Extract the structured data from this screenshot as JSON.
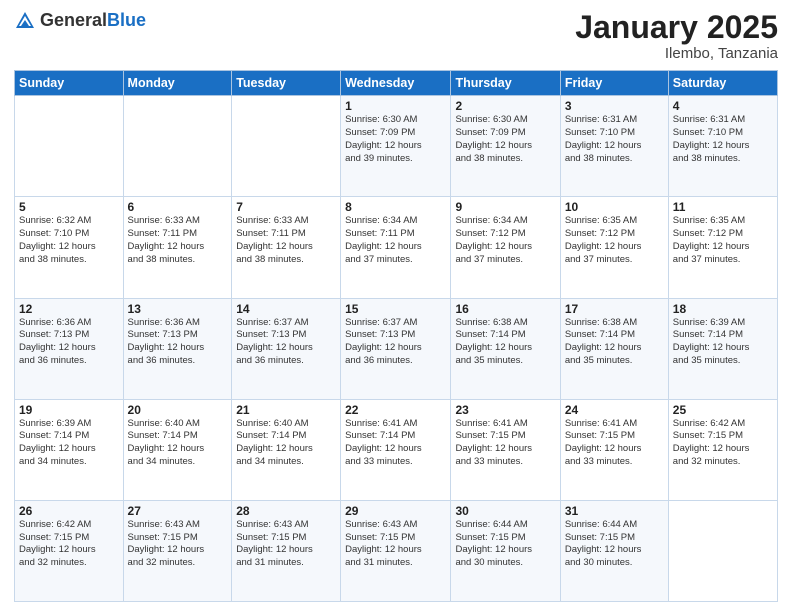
{
  "header": {
    "logo_general": "General",
    "logo_blue": "Blue",
    "month": "January 2025",
    "location": "Ilembo, Tanzania"
  },
  "weekdays": [
    "Sunday",
    "Monday",
    "Tuesday",
    "Wednesday",
    "Thursday",
    "Friday",
    "Saturday"
  ],
  "weeks": [
    [
      {
        "day": "",
        "info": ""
      },
      {
        "day": "",
        "info": ""
      },
      {
        "day": "",
        "info": ""
      },
      {
        "day": "1",
        "info": "Sunrise: 6:30 AM\nSunset: 7:09 PM\nDaylight: 12 hours\nand 39 minutes."
      },
      {
        "day": "2",
        "info": "Sunrise: 6:30 AM\nSunset: 7:09 PM\nDaylight: 12 hours\nand 38 minutes."
      },
      {
        "day": "3",
        "info": "Sunrise: 6:31 AM\nSunset: 7:10 PM\nDaylight: 12 hours\nand 38 minutes."
      },
      {
        "day": "4",
        "info": "Sunrise: 6:31 AM\nSunset: 7:10 PM\nDaylight: 12 hours\nand 38 minutes."
      }
    ],
    [
      {
        "day": "5",
        "info": "Sunrise: 6:32 AM\nSunset: 7:10 PM\nDaylight: 12 hours\nand 38 minutes."
      },
      {
        "day": "6",
        "info": "Sunrise: 6:33 AM\nSunset: 7:11 PM\nDaylight: 12 hours\nand 38 minutes."
      },
      {
        "day": "7",
        "info": "Sunrise: 6:33 AM\nSunset: 7:11 PM\nDaylight: 12 hours\nand 38 minutes."
      },
      {
        "day": "8",
        "info": "Sunrise: 6:34 AM\nSunset: 7:11 PM\nDaylight: 12 hours\nand 37 minutes."
      },
      {
        "day": "9",
        "info": "Sunrise: 6:34 AM\nSunset: 7:12 PM\nDaylight: 12 hours\nand 37 minutes."
      },
      {
        "day": "10",
        "info": "Sunrise: 6:35 AM\nSunset: 7:12 PM\nDaylight: 12 hours\nand 37 minutes."
      },
      {
        "day": "11",
        "info": "Sunrise: 6:35 AM\nSunset: 7:12 PM\nDaylight: 12 hours\nand 37 minutes."
      }
    ],
    [
      {
        "day": "12",
        "info": "Sunrise: 6:36 AM\nSunset: 7:13 PM\nDaylight: 12 hours\nand 36 minutes."
      },
      {
        "day": "13",
        "info": "Sunrise: 6:36 AM\nSunset: 7:13 PM\nDaylight: 12 hours\nand 36 minutes."
      },
      {
        "day": "14",
        "info": "Sunrise: 6:37 AM\nSunset: 7:13 PM\nDaylight: 12 hours\nand 36 minutes."
      },
      {
        "day": "15",
        "info": "Sunrise: 6:37 AM\nSunset: 7:13 PM\nDaylight: 12 hours\nand 36 minutes."
      },
      {
        "day": "16",
        "info": "Sunrise: 6:38 AM\nSunset: 7:14 PM\nDaylight: 12 hours\nand 35 minutes."
      },
      {
        "day": "17",
        "info": "Sunrise: 6:38 AM\nSunset: 7:14 PM\nDaylight: 12 hours\nand 35 minutes."
      },
      {
        "day": "18",
        "info": "Sunrise: 6:39 AM\nSunset: 7:14 PM\nDaylight: 12 hours\nand 35 minutes."
      }
    ],
    [
      {
        "day": "19",
        "info": "Sunrise: 6:39 AM\nSunset: 7:14 PM\nDaylight: 12 hours\nand 34 minutes."
      },
      {
        "day": "20",
        "info": "Sunrise: 6:40 AM\nSunset: 7:14 PM\nDaylight: 12 hours\nand 34 minutes."
      },
      {
        "day": "21",
        "info": "Sunrise: 6:40 AM\nSunset: 7:14 PM\nDaylight: 12 hours\nand 34 minutes."
      },
      {
        "day": "22",
        "info": "Sunrise: 6:41 AM\nSunset: 7:14 PM\nDaylight: 12 hours\nand 33 minutes."
      },
      {
        "day": "23",
        "info": "Sunrise: 6:41 AM\nSunset: 7:15 PM\nDaylight: 12 hours\nand 33 minutes."
      },
      {
        "day": "24",
        "info": "Sunrise: 6:41 AM\nSunset: 7:15 PM\nDaylight: 12 hours\nand 33 minutes."
      },
      {
        "day": "25",
        "info": "Sunrise: 6:42 AM\nSunset: 7:15 PM\nDaylight: 12 hours\nand 32 minutes."
      }
    ],
    [
      {
        "day": "26",
        "info": "Sunrise: 6:42 AM\nSunset: 7:15 PM\nDaylight: 12 hours\nand 32 minutes."
      },
      {
        "day": "27",
        "info": "Sunrise: 6:43 AM\nSunset: 7:15 PM\nDaylight: 12 hours\nand 32 minutes."
      },
      {
        "day": "28",
        "info": "Sunrise: 6:43 AM\nSunset: 7:15 PM\nDaylight: 12 hours\nand 31 minutes."
      },
      {
        "day": "29",
        "info": "Sunrise: 6:43 AM\nSunset: 7:15 PM\nDaylight: 12 hours\nand 31 minutes."
      },
      {
        "day": "30",
        "info": "Sunrise: 6:44 AM\nSunset: 7:15 PM\nDaylight: 12 hours\nand 30 minutes."
      },
      {
        "day": "31",
        "info": "Sunrise: 6:44 AM\nSunset: 7:15 PM\nDaylight: 12 hours\nand 30 minutes."
      },
      {
        "day": "",
        "info": ""
      }
    ]
  ]
}
